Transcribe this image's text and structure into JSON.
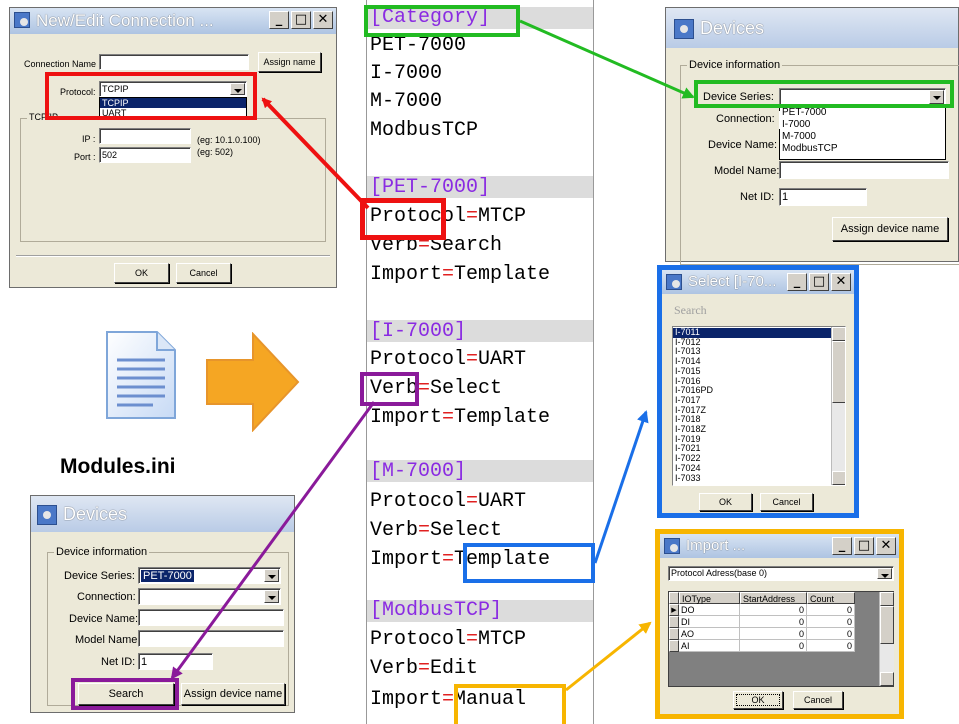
{
  "connection_window": {
    "title": "New/Edit Connection ...",
    "connection_name_label": "Connection Name :",
    "assign_name_button": "Assign name",
    "protocol_label": "Protocol:",
    "protocol_value": "TCPIP",
    "protocol_options": [
      "TCPIP",
      "UART"
    ],
    "group_label": "TCP/IP",
    "ip_label": "IP :",
    "ip_hint": "(eg: 10.1.0.100)",
    "port_label": "Port :",
    "port_value": "502",
    "port_hint": "(eg: 502)",
    "ok_button": "OK",
    "cancel_button": "Cancel"
  },
  "modules_file": {
    "filename": "Modules.ini",
    "sections": [
      {
        "header": "[Category]",
        "lines": [
          {
            "text": "PET-7000"
          },
          {
            "text": "I-7000"
          },
          {
            "text": "M-7000"
          },
          {
            "text": "ModbusTCP"
          }
        ]
      },
      {
        "header": "[PET-7000]",
        "lines": [
          {
            "key": "Protocol",
            "value": "MTCP"
          },
          {
            "key": "Verb",
            "value": "Search"
          },
          {
            "key": "Import",
            "value": "Template"
          }
        ]
      },
      {
        "header": "[I-7000]",
        "lines": [
          {
            "key": "Protocol",
            "value": "UART"
          },
          {
            "key": "Verb",
            "value": "Select"
          },
          {
            "key": "Import",
            "value": "Template"
          }
        ]
      },
      {
        "header": "[M-7000]",
        "lines": [
          {
            "key": "Protocol",
            "value": "UART"
          },
          {
            "key": "Verb",
            "value": "Select"
          },
          {
            "key": "Import",
            "value": "Template"
          }
        ]
      },
      {
        "header": "[ModbusTCP]",
        "lines": [
          {
            "key": "Protocol",
            "value": "MTCP"
          },
          {
            "key": "Verb",
            "value": "Edit"
          },
          {
            "key": "Import",
            "value": "Manual"
          }
        ]
      }
    ],
    "equals": "="
  },
  "devices_top": {
    "title": "Devices",
    "group_label": "Device information",
    "device_series_label": "Device Series:",
    "device_series_options": [
      "PET-7000",
      "I-7000",
      "M-7000",
      "ModbusTCP"
    ],
    "connection_label": "Connection:",
    "device_name_label": "Device Name:",
    "model_name_label": "Model Name:",
    "net_id_label": "Net ID:",
    "net_id_value": "1",
    "assign_device_name_button": "Assign device name"
  },
  "devices_bottom": {
    "title": "Devices",
    "group_label": "Device information",
    "device_series_label": "Device Series:",
    "device_series_value": "PET-7000",
    "connection_label": "Connection:",
    "device_name_label": "Device Name:",
    "model_name_label": "Model Name:",
    "net_id_label": "Net ID:",
    "net_id_value": "1",
    "search_button": "Search",
    "assign_device_name_button": "Assign device name"
  },
  "select_window": {
    "title": "Select [I-70...",
    "search_label": "Search",
    "items": [
      "I-7011",
      "I-7012",
      "I-7013",
      "I-7014",
      "I-7015",
      "I-7016",
      "I-7016PD",
      "I-7017",
      "I-7017Z",
      "I-7018",
      "I-7018Z",
      "I-7019",
      "I-7021",
      "I-7022",
      "I-7024",
      "I-7033"
    ],
    "ok_button": "OK",
    "cancel_button": "Cancel"
  },
  "import_window": {
    "title": "Import ...",
    "dropdown_value": "Protocol Adress(base 0)",
    "columns": [
      "IOType",
      "StartAddress",
      "Count"
    ],
    "rows": [
      {
        "type": "DO",
        "start": "0",
        "count": "0"
      },
      {
        "type": "DI",
        "start": "0",
        "count": "0"
      },
      {
        "type": "AO",
        "start": "0",
        "count": "0"
      },
      {
        "type": "AI",
        "start": "0",
        "count": "0"
      }
    ],
    "ok_button": "OK",
    "cancel_button": "Cancel"
  },
  "colors": {
    "red": "#ee1111",
    "green": "#22bb22",
    "purple": "#8a1a9a",
    "blue": "#1a6fe8",
    "gold": "#f7b500",
    "arrow_orange": "#f5a623"
  }
}
